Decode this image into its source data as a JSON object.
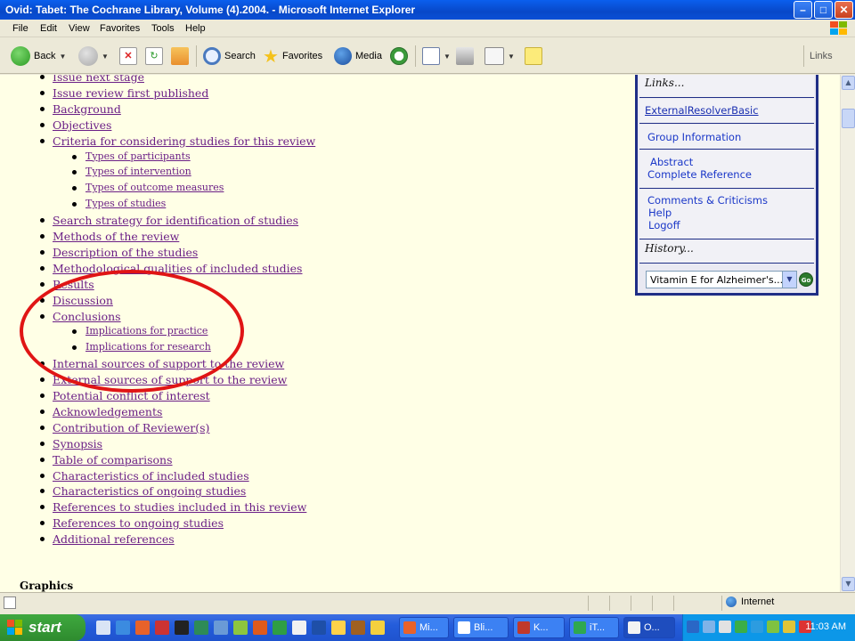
{
  "window": {
    "title": "Ovid: Tabet: The Cochrane Library, Volume (4).2004. - Microsoft Internet Explorer"
  },
  "menu": [
    "File",
    "Edit",
    "View",
    "Favorites",
    "Tools",
    "Help"
  ],
  "toolbar": {
    "back_label": "Back",
    "search_label": "Search",
    "favorites_label": "Favorites",
    "media_label": "Media",
    "links_label": "Links"
  },
  "toc": [
    {
      "label": "Issue next stage",
      "level": 1
    },
    {
      "label": "Issue review first published",
      "level": 1
    },
    {
      "label": "Background",
      "level": 1
    },
    {
      "label": "Objectives",
      "level": 1
    },
    {
      "label": "Criteria for considering studies for this review",
      "level": 1
    },
    {
      "label": "Types of participants",
      "level": 2
    },
    {
      "label": "Types of intervention",
      "level": 2
    },
    {
      "label": "Types of outcome measures",
      "level": 2
    },
    {
      "label": "Types of studies",
      "level": 2
    },
    {
      "label": "Search strategy for identification of studies",
      "level": 1
    },
    {
      "label": "Methods of the review",
      "level": 1
    },
    {
      "label": "Description of the studies",
      "level": 1
    },
    {
      "label": "Methodological qualities of included studies",
      "level": 1
    },
    {
      "label": "Results",
      "level": 1
    },
    {
      "label": "Discussion",
      "level": 1
    },
    {
      "label": "Conclusions",
      "level": 1
    },
    {
      "label": "Implications for practice",
      "level": 2
    },
    {
      "label": "Implications for research",
      "level": 2
    },
    {
      "label": "Internal sources of support to the review",
      "level": 1
    },
    {
      "label": "External sources of support to the review",
      "level": 1
    },
    {
      "label": "Potential conflict of interest",
      "level": 1
    },
    {
      "label": "Acknowledgements",
      "level": 1
    },
    {
      "label": "Contribution of Reviewer(s)",
      "level": 1
    },
    {
      "label": "Synopsis",
      "level": 1
    },
    {
      "label": "Table of comparisons",
      "level": 1
    },
    {
      "label": "Characteristics of included studies",
      "level": 1
    },
    {
      "label": "Characteristics of ongoing studies",
      "level": 1
    },
    {
      "label": "References to studies included in this review",
      "level": 1
    },
    {
      "label": "References to ongoing studies",
      "level": 1
    },
    {
      "label": "Additional references",
      "level": 1
    }
  ],
  "graphics_heading": "Graphics",
  "sidebar": {
    "links_header": "Links...",
    "external_resolver": "ExternalResolverBasic",
    "group_information": "Group Information",
    "abstract": "Abstract",
    "complete_reference": "Complete Reference",
    "comments": "Comments & Criticisms",
    "help": "Help",
    "logoff": "Logoff",
    "history_header": "History...",
    "history_selected": "Vitamin E for Alzheimer's...",
    "go_label": "Go"
  },
  "status": {
    "zone": "Internet"
  },
  "taskbar": {
    "start_label": "start",
    "buttons": [
      "Mi...",
      "Bli...",
      "K...",
      "iT...",
      "O..."
    ],
    "clock": "11:03 AM"
  },
  "colors": {
    "link_visited": "#6B1F86",
    "annotation": "#E01515",
    "sidebar_border": "#1F2E86",
    "page_bg": "#FFFFE6"
  }
}
